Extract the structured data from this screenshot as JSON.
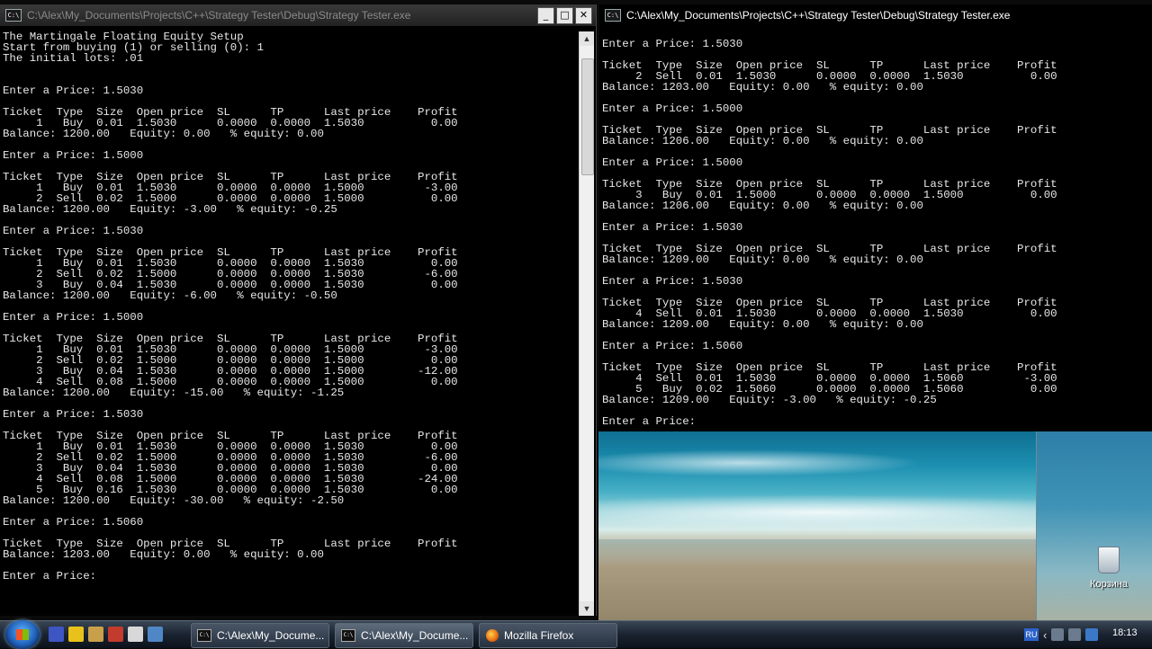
{
  "left_window": {
    "title": "C:\\Alex\\My_Documents\\Projects\\C++\\Strategy Tester\\Debug\\Strategy Tester.exe",
    "icon": "C:\\",
    "controls": {
      "minimize": "_",
      "maximize": "□",
      "close": "✕"
    },
    "scroll_up": "▲",
    "scroll_down": "▼",
    "lines": [
      "The Martingale Floating Equity Setup",
      "Start from buying (1) or selling (0): 1",
      "The initial lots: .01",
      "",
      "",
      "Enter a Price: 1.5030",
      "",
      "Ticket  Type  Size  Open price  SL      TP      Last price    Profit",
      "     1   Buy  0.01  1.5030      0.0000  0.0000  1.5030          0.00",
      "Balance: 1200.00   Equity: 0.00   % equity: 0.00",
      "",
      "Enter a Price: 1.5000",
      "",
      "Ticket  Type  Size  Open price  SL      TP      Last price    Profit",
      "     1   Buy  0.01  1.5030      0.0000  0.0000  1.5000         -3.00",
      "     2  Sell  0.02  1.5000      0.0000  0.0000  1.5000          0.00",
      "Balance: 1200.00   Equity: -3.00   % equity: -0.25",
      "",
      "Enter a Price: 1.5030",
      "",
      "Ticket  Type  Size  Open price  SL      TP      Last price    Profit",
      "     1   Buy  0.01  1.5030      0.0000  0.0000  1.5030          0.00",
      "     2  Sell  0.02  1.5000      0.0000  0.0000  1.5030         -6.00",
      "     3   Buy  0.04  1.5030      0.0000  0.0000  1.5030          0.00",
      "Balance: 1200.00   Equity: -6.00   % equity: -0.50",
      "",
      "Enter a Price: 1.5000",
      "",
      "Ticket  Type  Size  Open price  SL      TP      Last price    Profit",
      "     1   Buy  0.01  1.5030      0.0000  0.0000  1.5000         -3.00",
      "     2  Sell  0.02  1.5000      0.0000  0.0000  1.5000          0.00",
      "     3   Buy  0.04  1.5030      0.0000  0.0000  1.5000        -12.00",
      "     4  Sell  0.08  1.5000      0.0000  0.0000  1.5000          0.00",
      "Balance: 1200.00   Equity: -15.00   % equity: -1.25",
      "",
      "Enter a Price: 1.5030",
      "",
      "Ticket  Type  Size  Open price  SL      TP      Last price    Profit",
      "     1   Buy  0.01  1.5030      0.0000  0.0000  1.5030          0.00",
      "     2  Sell  0.02  1.5000      0.0000  0.0000  1.5030         -6.00",
      "     3   Buy  0.04  1.5030      0.0000  0.0000  1.5030          0.00",
      "     4  Sell  0.08  1.5000      0.0000  0.0000  1.5030        -24.00",
      "     5   Buy  0.16  1.5030      0.0000  0.0000  1.5030          0.00",
      "Balance: 1200.00   Equity: -30.00   % equity: -2.50",
      "",
      "Enter a Price: 1.5060",
      "",
      "Ticket  Type  Size  Open price  SL      TP      Last price    Profit",
      "Balance: 1203.00   Equity: 0.00   % equity: 0.00",
      "",
      "Enter a Price:"
    ]
  },
  "right_window": {
    "title": "C:\\Alex\\My_Documents\\Projects\\C++\\Strategy Tester\\Debug\\Strategy Tester.exe",
    "icon": "C:\\",
    "lines": [
      "Enter a Price: 1.5030",
      "",
      "Ticket  Type  Size  Open price  SL      TP      Last price    Profit",
      "     2  Sell  0.01  1.5030      0.0000  0.0000  1.5030          0.00",
      "Balance: 1203.00   Equity: 0.00   % equity: 0.00",
      "",
      "Enter a Price: 1.5000",
      "",
      "Ticket  Type  Size  Open price  SL      TP      Last price    Profit",
      "Balance: 1206.00   Equity: 0.00   % equity: 0.00",
      "",
      "Enter a Price: 1.5000",
      "",
      "Ticket  Type  Size  Open price  SL      TP      Last price    Profit",
      "     3   Buy  0.01  1.5000      0.0000  0.0000  1.5000          0.00",
      "Balance: 1206.00   Equity: 0.00   % equity: 0.00",
      "",
      "Enter a Price: 1.5030",
      "",
      "Ticket  Type  Size  Open price  SL      TP      Last price    Profit",
      "Balance: 1209.00   Equity: 0.00   % equity: 0.00",
      "",
      "Enter a Price: 1.5030",
      "",
      "Ticket  Type  Size  Open price  SL      TP      Last price    Profit",
      "     4  Sell  0.01  1.5030      0.0000  0.0000  1.5030          0.00",
      "Balance: 1209.00   Equity: 0.00   % equity: 0.00",
      "",
      "Enter a Price: 1.5060",
      "",
      "Ticket  Type  Size  Open price  SL      TP      Last price    Profit",
      "     4  Sell  0.01  1.5030      0.0000  0.0000  1.5060         -3.00",
      "     5   Buy  0.02  1.5060      0.0000  0.0000  1.5060          0.00",
      "Balance: 1209.00   Equity: -3.00   % equity: -0.25",
      "",
      "Enter a Price:"
    ]
  },
  "desktop": {
    "recycle_bin_label": "Корзина"
  },
  "taskbar": {
    "tasks": [
      {
        "label": "C:\\Alex\\My_Docume...",
        "icon": "C:\\"
      },
      {
        "label": "C:\\Alex\\My_Docume...",
        "icon": "C:\\"
      },
      {
        "label": "Mozilla Firefox"
      }
    ],
    "language": "RU",
    "tray_chevron": "‹",
    "clock": "18:13",
    "quick_launch_colors": [
      "#3d56c4",
      "#e8c21a",
      "#c9a04a",
      "#c23b2d",
      "#d8d8d8",
      "#4f86c6"
    ]
  }
}
